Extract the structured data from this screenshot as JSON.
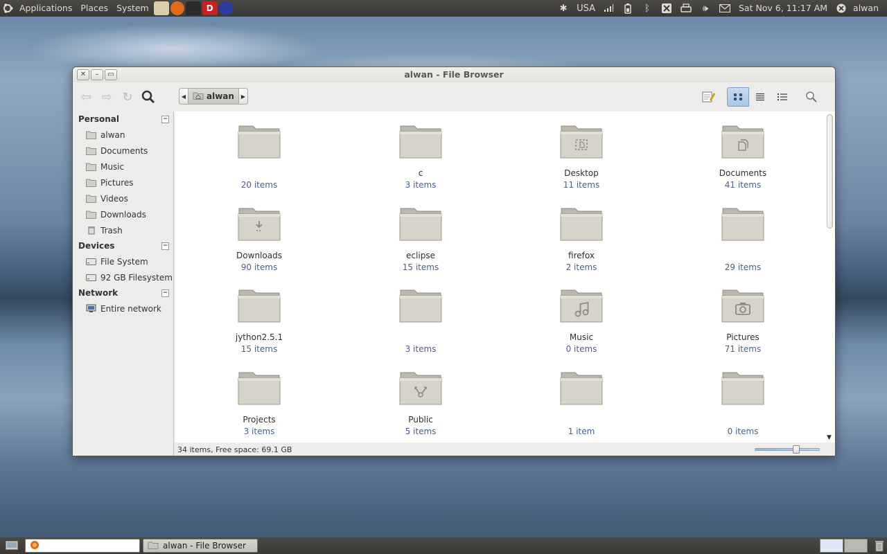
{
  "top_panel": {
    "menus": [
      "Applications",
      "Places",
      "System"
    ],
    "launchers": [
      {
        "icon": "text-editor-icon",
        "color": "#d9cfa8"
      },
      {
        "icon": "firefox-icon",
        "color": "#e06a1a"
      },
      {
        "icon": "terminal-icon",
        "color": "#2b2b2b"
      },
      {
        "icon": "d-app-icon",
        "color": "#c92020",
        "glyph": "D"
      },
      {
        "icon": "eclipse-icon",
        "color": "#2c3c9e"
      }
    ],
    "network_label": "USA",
    "datetime": "Sat Nov  6, 11:17 AM",
    "user": "alwan"
  },
  "window": {
    "title": "alwan - File Browser",
    "path_crumb": "alwan",
    "accent": "#a9c4e6"
  },
  "sidebar": {
    "sections": [
      {
        "title": "Personal",
        "items": [
          {
            "label": "alwan",
            "icon": "home-folder-icon"
          },
          {
            "label": "Documents",
            "icon": "documents-folder-icon"
          },
          {
            "label": "Music",
            "icon": "music-folder-icon"
          },
          {
            "label": "Pictures",
            "icon": "pictures-folder-icon"
          },
          {
            "label": "Videos",
            "icon": "videos-folder-icon"
          },
          {
            "label": "Downloads",
            "icon": "downloads-folder-icon"
          },
          {
            "label": "Trash",
            "icon": "trash-icon"
          }
        ]
      },
      {
        "title": "Devices",
        "items": [
          {
            "label": "File System",
            "icon": "drive-icon"
          },
          {
            "label": "92 GB Filesystem",
            "icon": "drive-icon"
          }
        ]
      },
      {
        "title": "Network",
        "items": [
          {
            "label": "Entire network",
            "icon": "network-icon"
          }
        ]
      }
    ]
  },
  "files": [
    {
      "name": "",
      "count": "20 items",
      "emblem": "none"
    },
    {
      "name": "c",
      "count": "3 items",
      "emblem": "none"
    },
    {
      "name": "Desktop",
      "count": "11 items",
      "emblem": "desktop"
    },
    {
      "name": "Documents",
      "count": "41 items",
      "emblem": "documents"
    },
    {
      "name": "Downloads",
      "count": "90 items",
      "emblem": "downloads"
    },
    {
      "name": "eclipse",
      "count": "15 items",
      "emblem": "none"
    },
    {
      "name": "firefox",
      "count": "2 items",
      "emblem": "none"
    },
    {
      "name": "",
      "count": "29 items",
      "emblem": "none"
    },
    {
      "name": "jython2.5.1",
      "count": "15 items",
      "emblem": "none"
    },
    {
      "name": "",
      "count": "3 items",
      "emblem": "none"
    },
    {
      "name": "Music",
      "count": "0 items",
      "emblem": "music"
    },
    {
      "name": "Pictures",
      "count": "71 items",
      "emblem": "pictures"
    },
    {
      "name": "Projects",
      "count": "3 items",
      "emblem": "none"
    },
    {
      "name": "Public",
      "count": "5 items",
      "emblem": "public"
    },
    {
      "name": "",
      "count": "1 item",
      "emblem": "none"
    },
    {
      "name": "",
      "count": "0 items",
      "emblem": "none"
    }
  ],
  "status": {
    "text": "34 items, Free space: 69.1 GB",
    "zoom_level": 0.6
  },
  "taskbar": {
    "tasks": [
      {
        "label": "",
        "icon": "firefox-icon"
      },
      {
        "label": "alwan - File Browser",
        "icon": "file-browser-icon"
      }
    ]
  }
}
